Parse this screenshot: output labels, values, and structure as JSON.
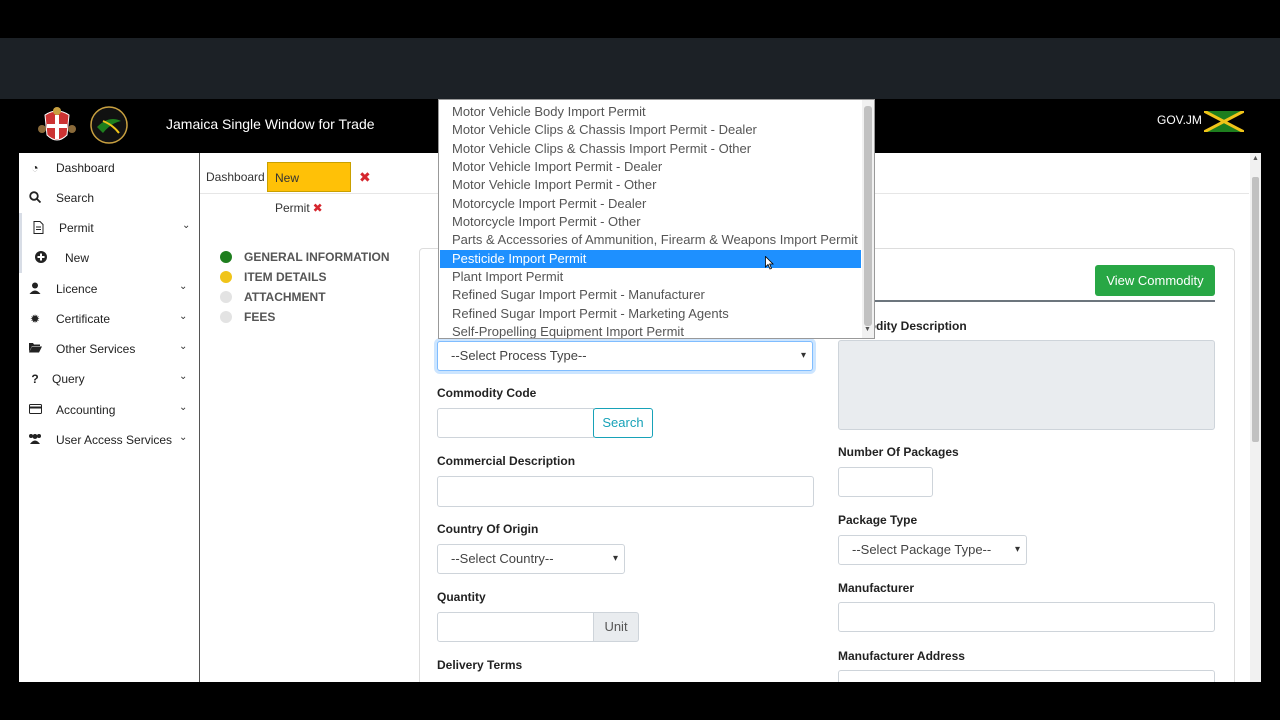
{
  "header": {
    "title": "Jamaica Single Window for Trade",
    "gov_label": "GOV.JM"
  },
  "sidebar": {
    "items": [
      {
        "label": "Dashboard",
        "icon": "tachometer-icon"
      },
      {
        "label": "Search",
        "icon": "search-icon"
      },
      {
        "label": "Permit",
        "icon": "file-icon"
      },
      {
        "label": "New",
        "icon": "plus-circle-icon"
      },
      {
        "label": "Licence",
        "icon": "user-icon"
      },
      {
        "label": "Certificate",
        "icon": "certificate-icon"
      },
      {
        "label": "Other Services",
        "icon": "folder-open-icon"
      },
      {
        "label": "Query",
        "icon": "question-icon"
      },
      {
        "label": "Accounting",
        "icon": "credit-card-icon"
      },
      {
        "label": "User Access Services",
        "icon": "users-icon"
      }
    ]
  },
  "tabs": {
    "dashboard": "Dashboard",
    "new_permit": "New Permit",
    "close_symbol": "✖"
  },
  "steps": [
    {
      "label": "GENERAL INFORMATION",
      "color": "#1e7e1e"
    },
    {
      "label": "ITEM DETAILS",
      "color": "#f0c419"
    },
    {
      "label": "ATTACHMENT",
      "color": "#e3e3e3"
    },
    {
      "label": "FEES",
      "color": "#e3e3e3"
    }
  ],
  "form": {
    "view_commodity_button": "View Commodity",
    "process_type_select": "--Select Process Type--",
    "commodity_code_label": "Commodity Code",
    "search_button": "Search",
    "commercial_description_label": "Commercial Description",
    "country_of_origin_label": "Country Of Origin",
    "country_select": "--Select Country--",
    "quantity_label": "Quantity",
    "unit_addon": "Unit",
    "delivery_terms_label": "Delivery Terms",
    "commodity_description_label": "modity Description",
    "number_of_packages_label": "Number Of Packages",
    "package_type_label": "Package Type",
    "package_type_select": "--Select Package Type--",
    "manufacturer_label": "Manufacturer",
    "manufacturer_address_label": "Manufacturer Address"
  },
  "dropdown": {
    "options": [
      "Motor Vehicle Body Import Permit",
      "Motor Vehicle Clips & Chassis Import Permit - Dealer",
      "Motor Vehicle Clips & Chassis Import Permit - Other",
      "Motor Vehicle Import Permit - Dealer",
      "Motor Vehicle Import Permit - Other",
      "Motorcycle Import Permit - Dealer",
      "Motorcycle Import Permit - Other",
      "Parts & Accessories of Ammunition, Firearm & Weapons Import Permit",
      "Pesticide Import Permit",
      "Plant Import Permit",
      "Refined Sugar Import Permit - Manufacturer",
      "Refined Sugar Import Permit - Marketing Agents",
      "Self-Propelling Equipment Import Permit"
    ],
    "selected": "Pesticide Import Permit"
  },
  "colors": {
    "accent_green": "#28a745",
    "tab_yellow": "#ffc107",
    "highlight_blue": "#1e90ff",
    "close_red": "#d6262e"
  }
}
